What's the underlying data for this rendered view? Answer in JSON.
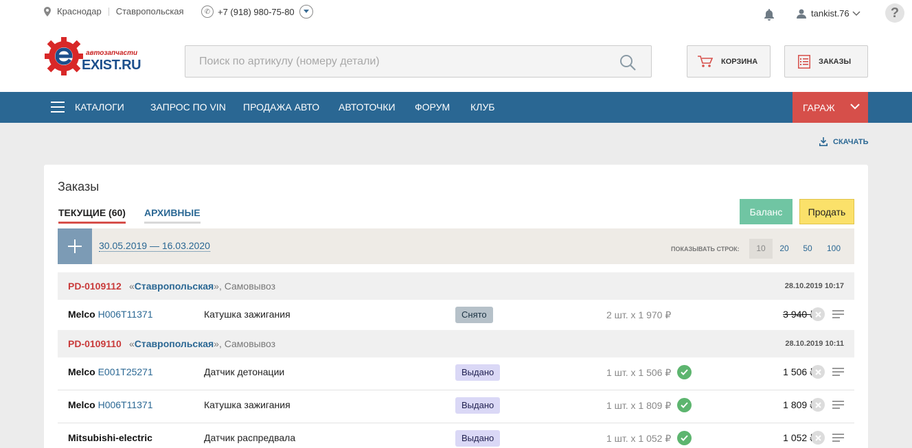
{
  "topbar": {
    "city": "Краснодар",
    "store": "Ставропольская",
    "phone": "+7 (918) 980-75-80",
    "username": "tankist.76",
    "help": "?"
  },
  "logo": {
    "slogan": "автозапчасти",
    "brand": "EXIST.RU"
  },
  "search": {
    "placeholder": "Поиск по артикулу (номеру детали)"
  },
  "header_buttons": {
    "cart": "КОРЗИНА",
    "orders": "ЗАКАЗЫ"
  },
  "nav": {
    "items": [
      "КАТАЛОГИ",
      "ЗАПРОС ПО VIN",
      "ПРОДАЖА АВТО",
      "АВТОТОЧКИ",
      "ФОРУМ",
      "КЛУБ"
    ],
    "garage": "ГАРАЖ"
  },
  "download": "СКАЧАТЬ",
  "orders_page": {
    "title": "Заказы",
    "tab_current": "ТЕКУЩИЕ (60)",
    "tab_archive": "АРХИВНЫЕ",
    "balance_btn": "Баланс",
    "sell_btn": "Продать",
    "date_range": "30.05.2019 — 16.03.2020",
    "rows_label": "ПОКАЗЫВАТЬ СТРОК:",
    "rows_options": [
      "10",
      "20",
      "50",
      "100"
    ],
    "rows_selected": "10"
  },
  "groups": [
    {
      "id": "PD-0109112",
      "quote_open": "«",
      "store": "Ставропольская",
      "quote_close": "», Самовывоз",
      "date": "28.10.2019 10:17",
      "items": [
        {
          "brand": "Melco",
          "article": "H006T11371",
          "name": "Катушка зажигания",
          "status": "Снято",
          "qty": "2 шт. x 1 970 ₽",
          "sum": "3 940 ₽",
          "confirmed": false,
          "struck": true
        }
      ]
    },
    {
      "id": "PD-0109110",
      "quote_open": "«",
      "store": "Ставропольская",
      "quote_close": "», Самовывоз",
      "date": "28.10.2019 10:11",
      "items": [
        {
          "brand": "Melco",
          "article": "E001T25271",
          "name": "Датчик детонации",
          "status": "Выдано",
          "qty": "1 шт. x 1 506 ₽",
          "sum": "1 506 ₽",
          "confirmed": true,
          "struck": false
        },
        {
          "brand": "Melco",
          "article": "H006T11371",
          "name": "Катушка зажигания",
          "status": "Выдано",
          "qty": "1 шт. x 1 809 ₽",
          "sum": "1 809 ₽",
          "confirmed": true,
          "struck": false
        },
        {
          "brand": "Mitsubishi-electric",
          "article": "",
          "name": "Датчик распредвала",
          "status": "Выдано",
          "qty": "1 шт. x 1 052 ₽",
          "sum": "1 052 ₽",
          "confirmed": true,
          "struck": false
        }
      ]
    }
  ],
  "colors": {
    "accent": "#2a6793",
    "garage": "#d64f4a",
    "order_id": "#c93a3a",
    "balance": "#70c5a3",
    "sell": "#fbe16a"
  }
}
